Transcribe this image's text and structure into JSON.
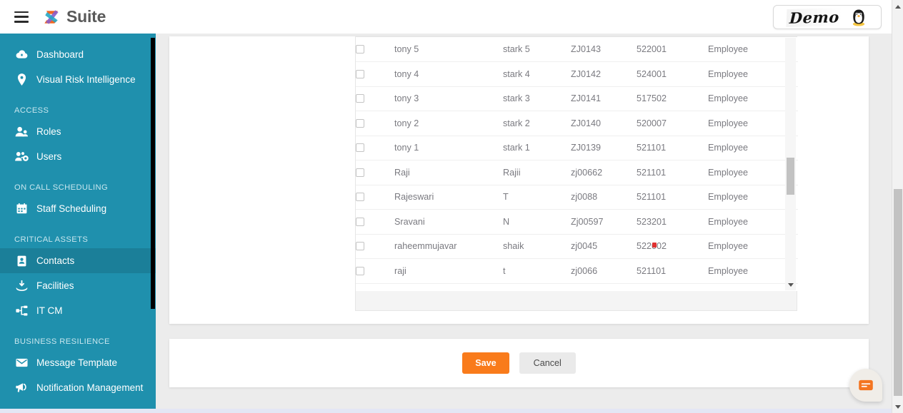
{
  "header": {
    "menu_icon": "hamburger-icon",
    "brand_mark": "z-logo-icon",
    "brand_text": "Suite",
    "demo_label": "Demo",
    "avatar_icon": "penguin-avatar-icon"
  },
  "sidebar": {
    "accent_color": "#1f90ad",
    "active_color": "#1b7f99",
    "entries": [
      {
        "kind": "item",
        "label": "Dashboard",
        "icon": "cloud-icon",
        "active": false
      },
      {
        "kind": "item",
        "label": "Visual Risk Intelligence",
        "icon": "map-pin-icon",
        "active": false
      },
      {
        "kind": "section",
        "label": "ACCESS"
      },
      {
        "kind": "item",
        "label": "Roles",
        "icon": "user-icon",
        "active": false
      },
      {
        "kind": "item",
        "label": "Users",
        "icon": "users-gear-icon",
        "active": false
      },
      {
        "kind": "section",
        "label": "ON CALL SCHEDULING"
      },
      {
        "kind": "item",
        "label": "Staff Scheduling",
        "icon": "calendar-icon",
        "active": false
      },
      {
        "kind": "section",
        "label": "CRITICAL ASSETS"
      },
      {
        "kind": "item",
        "label": "Contacts",
        "icon": "contact-card-icon",
        "active": true
      },
      {
        "kind": "item",
        "label": "Facilities",
        "icon": "facility-icon",
        "active": false
      },
      {
        "kind": "item",
        "label": "IT CM",
        "icon": "sitemap-icon",
        "active": false
      },
      {
        "kind": "section",
        "label": "BUSINESS RESILIENCE"
      },
      {
        "kind": "item",
        "label": "Message Template",
        "icon": "envelope-icon",
        "active": false
      },
      {
        "kind": "item",
        "label": "Notification Management",
        "icon": "megaphone-icon",
        "active": false
      }
    ]
  },
  "table": {
    "rows": [
      {
        "first": "tony 5",
        "last": "stark 5",
        "id": "ZJ0143",
        "zip": "522001",
        "type": "Employee",
        "checked": false
      },
      {
        "first": "tony 4",
        "last": "stark 4",
        "id": "ZJ0142",
        "zip": "524001",
        "type": "Employee",
        "checked": false
      },
      {
        "first": "tony 3",
        "last": "stark 3",
        "id": "ZJ0141",
        "zip": "517502",
        "type": "Employee",
        "checked": false
      },
      {
        "first": "tony 2",
        "last": "stark 2",
        "id": "ZJ0140",
        "zip": "520007",
        "type": "Employee",
        "checked": false
      },
      {
        "first": "tony 1",
        "last": "stark 1",
        "id": "ZJ0139",
        "zip": "521101",
        "type": "Employee",
        "checked": false
      },
      {
        "first": "Raji",
        "last": "Rajii",
        "id": "zj00662",
        "zip": "521101",
        "type": "Employee",
        "checked": false
      },
      {
        "first": "Rajeswari",
        "last": "T",
        "id": "zj0088",
        "zip": "521101",
        "type": "Employee",
        "checked": false
      },
      {
        "first": "Sravani",
        "last": "N",
        "id": "Zj00597",
        "zip": "523201",
        "type": "Employee",
        "checked": false
      },
      {
        "first": "raheemmujavar",
        "last": "shaik",
        "id": "zj0045",
        "zip": "522002",
        "type": "Employee",
        "checked": false
      },
      {
        "first": "raji",
        "last": "t",
        "id": "zj0066",
        "zip": "521101",
        "type": "Employee",
        "checked": false
      }
    ]
  },
  "footer": {
    "save_label": "Save",
    "cancel_label": "Cancel",
    "save_color": "#f97b1b"
  },
  "chat": {
    "icon": "chat-bubble-icon"
  }
}
